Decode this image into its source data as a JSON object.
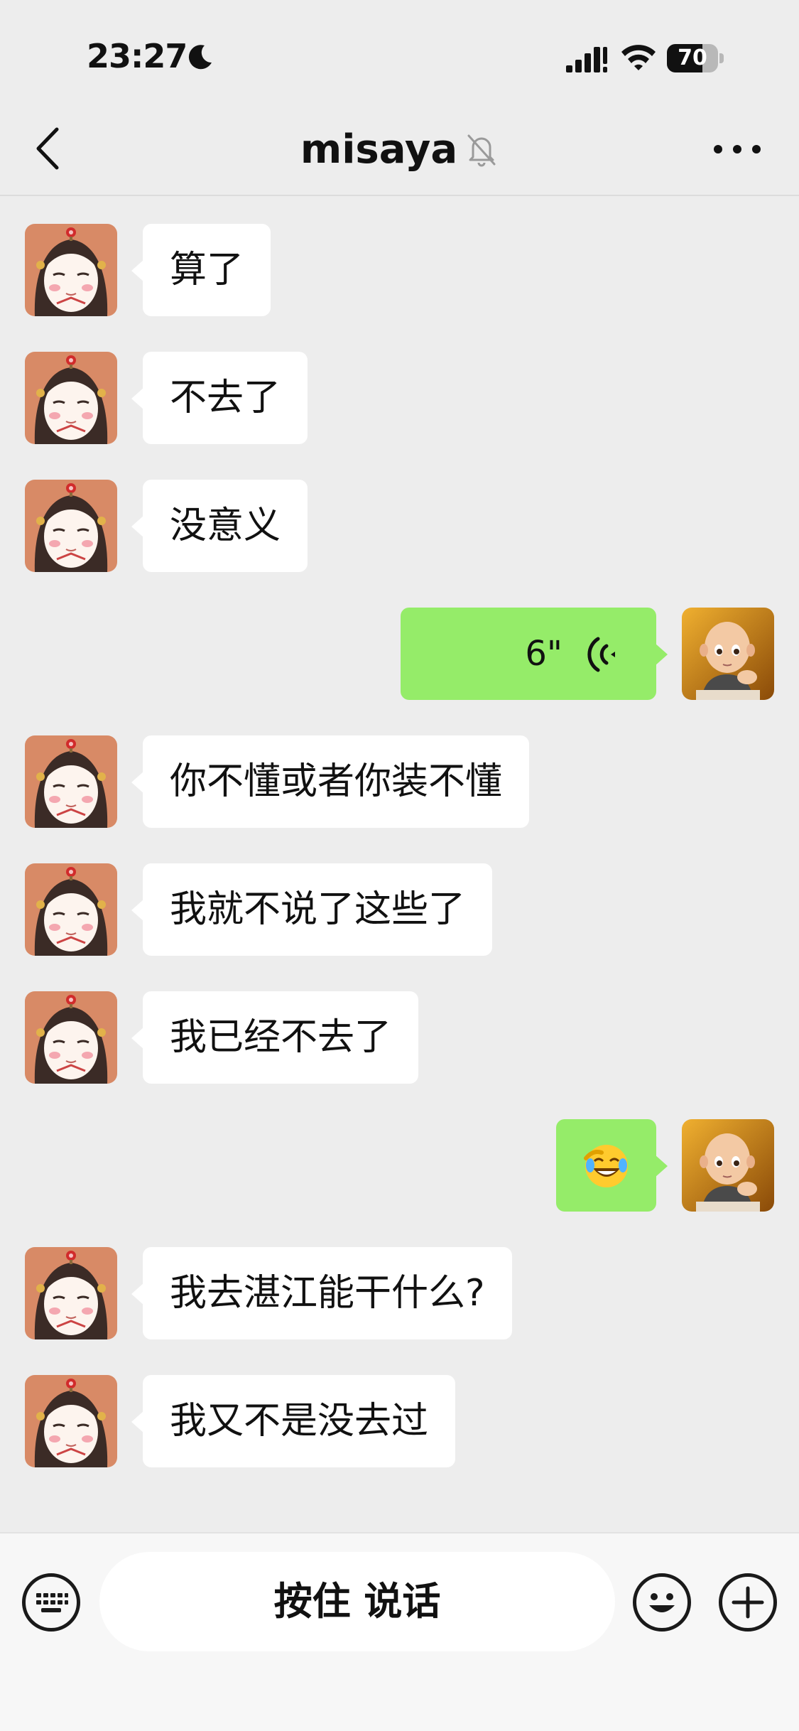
{
  "status_bar": {
    "time": "23:27",
    "battery_level": "70",
    "battery_fraction": 0.7,
    "icons": [
      "moon-icon",
      "signal-icon",
      "wifi-icon",
      "battery-icon"
    ]
  },
  "header": {
    "title": "misaya",
    "back_icon": "chevron-left-icon",
    "mute_icon": "bell-slash-icon",
    "more_icon": "ellipsis-icon"
  },
  "messages": [
    {
      "from": "them",
      "type": "text",
      "text": "算了"
    },
    {
      "from": "them",
      "type": "text",
      "text": "不去了"
    },
    {
      "from": "them",
      "type": "text",
      "text": "没意义"
    },
    {
      "from": "me",
      "type": "voice",
      "duration": "6\""
    },
    {
      "from": "them",
      "type": "text",
      "text": "你不懂或者你装不懂"
    },
    {
      "from": "them",
      "type": "text",
      "text": "我就不说了这些了"
    },
    {
      "from": "them",
      "type": "text",
      "text": "我已经不去了"
    },
    {
      "from": "me",
      "type": "emoji",
      "emoji": "face-with-tears-of-joy"
    },
    {
      "from": "them",
      "type": "text",
      "text": "我去湛江能干什么?"
    },
    {
      "from": "them",
      "type": "text",
      "text": "我又不是没去过"
    }
  ],
  "input_bar": {
    "hold_to_talk": "按住 说话",
    "icons": [
      "keyboard-icon",
      "emoji-icon",
      "plus-icon"
    ]
  },
  "colors": {
    "background": "#ededed",
    "incoming_bubble": "#ffffff",
    "outgoing_bubble": "#95ec69",
    "input_bar": "#f7f7f7"
  }
}
